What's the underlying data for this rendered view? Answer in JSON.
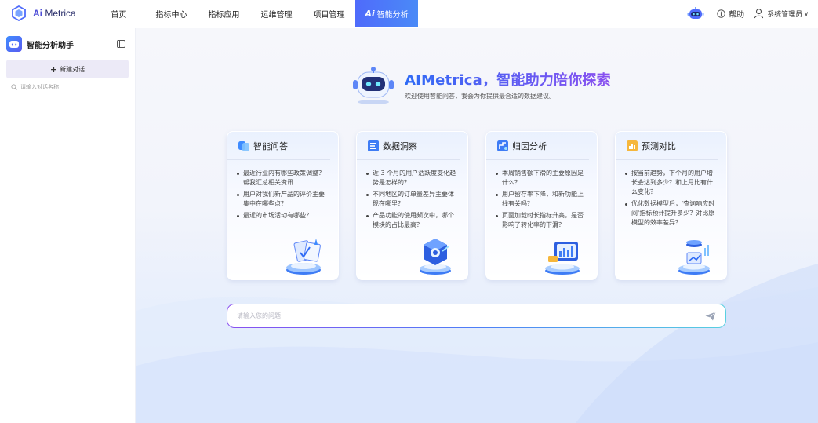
{
  "brand": {
    "prefix": "Ai",
    "name": " Metrica"
  },
  "nav": {
    "items": [
      {
        "label": "首页"
      },
      {
        "label": "指标中心"
      },
      {
        "label": "指标应用"
      },
      {
        "label": "运维管理"
      },
      {
        "label": "项目管理"
      }
    ],
    "active": {
      "prefix": "Ai",
      "label": "智能分析"
    },
    "help_label": "帮助",
    "user_label": "系统管理员",
    "user_chevron": "∨"
  },
  "sidebar": {
    "title": "智能分析助手",
    "new_chat_label": "新建对话",
    "search_placeholder": "请输入对话名称"
  },
  "hero": {
    "title": "AIMetrica，智能助力陪你探索",
    "subtitle": "欢迎使用智能问答，我会为你提供最合适的数据建议。"
  },
  "cards": [
    {
      "title": "智能问答",
      "icon": "chat-icon",
      "items": [
        "最近行业内有哪些政策调整？帮我汇总相关资讯",
        "用户对我们新产品的评价主要集中在哪些点？",
        "最近的市场活动有哪些？"
      ]
    },
    {
      "title": "数据洞察",
      "icon": "data-icon",
      "items": [
        "近 3 个月的用户活跃度变化趋势是怎样的？",
        "不同地区的订单量差异主要体现在哪里？",
        "产品功能的使用频次中，哪个模块的占比最高？"
      ]
    },
    {
      "title": "归因分析",
      "icon": "attribution-icon",
      "items": [
        "本周销售额下滑的主要原因是什么？",
        "用户留存率下降，和新功能上线有关吗？",
        "页面加载时长指标升高，是否影响了转化率的下滑？"
      ]
    },
    {
      "title": "预测对比",
      "icon": "forecast-icon",
      "items": [
        "按当前趋势，下个月的用户增长会达到多少？和上月比有什么变化？",
        "优化数据模型后，'查询响应时间'指标预计提升多少？对比原模型的效率差异？"
      ]
    }
  ],
  "ask": {
    "placeholder": "请输入您的问题"
  },
  "colors": {
    "accent": "#4f6bfb",
    "purple": "#8a4ff0",
    "cyan": "#58d0e0"
  }
}
